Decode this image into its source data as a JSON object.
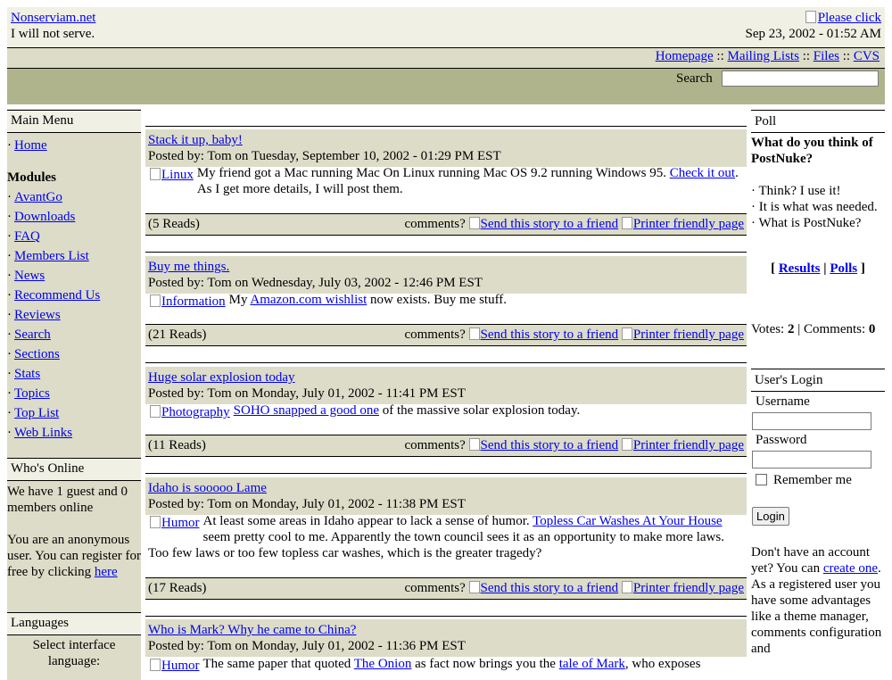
{
  "header": {
    "site_name": "Nonserviam.net",
    "tagline": "I will not serve.",
    "banner_alt": "Please click",
    "datetime": "Sep 23, 2002 - 01:52 AM"
  },
  "nav": {
    "links": [
      "Homepage",
      "Mailing Lists",
      "Files",
      "CVS"
    ],
    "separator": "::"
  },
  "search": {
    "label": "Search",
    "value": ""
  },
  "main_menu": {
    "title": "Main Menu",
    "home": "Home",
    "modules_heading": "Modules",
    "modules": [
      "AvantGo",
      "Downloads",
      "FAQ",
      "Members List",
      "News",
      "Recommend Us",
      "Reviews",
      "Search",
      "Sections",
      "Stats",
      "Topics",
      "Top List",
      "Web Links"
    ]
  },
  "whos_online": {
    "title": "Who's Online",
    "line1": "We have 1 guest and 0 members online",
    "line2": "You are an anonymous user. You can register for free by clicking",
    "link": "here"
  },
  "languages": {
    "title": "Languages",
    "text": "Select interface language:"
  },
  "stories": [
    {
      "title": "Stack it up, baby!",
      "posted": "Posted by: Tom on Tuesday, September 10, 2002 - 01:29 PM EST",
      "topic_alt": "Linux",
      "text_a": "My friend got a Mac running Mac On Linux running Mac OS 9.2 running Windows 95. ",
      "link": "Check it out",
      "text_b": ". As I get more details, I will post them.",
      "reads": "(5 Reads)"
    },
    {
      "title": "Buy me things.",
      "posted": "Posted by: Tom on Wednesday, July 03, 2002 - 12:46 PM EST",
      "topic_alt": "Information",
      "text_a": "My ",
      "link": "Amazon.com wishlist",
      "text_b": " now exists. Buy me stuff.",
      "reads": "(21 Reads)"
    },
    {
      "title": "Huge solar explosion today",
      "posted": "Posted by: Tom on Monday, July 01, 2002 - 11:41 PM EST",
      "topic_alt": "Photography",
      "text_a": "",
      "link": "SOHO snapped a good one",
      "text_b": " of the massive solar explosion today.",
      "reads": "(11 Reads)"
    },
    {
      "title": "Idaho is sooooo Lame",
      "posted": "Posted by: Tom on Monday, July 01, 2002 - 11:38 PM EST",
      "topic_alt": "Humor",
      "text_a": "At least some areas in Idaho appear to lack a sense of humor. ",
      "link": "Topless Car Washes At Your House",
      "text_b": " seem pretty cool to me. Apparently the town council sees it as an opportunity to make more laws. Too few laws or too few topless car washes, which is the greater tragedy?",
      "reads": "(17 Reads)"
    },
    {
      "title": "Who is Mark? Why he came to China?",
      "posted": "Posted by: Tom on Monday, July 01, 2002 - 11:36 PM EST",
      "topic_alt": "Humor",
      "text_a": "The same paper that quoted ",
      "link": "The Onion",
      "text_b": " as fact now brings you the ",
      "link2": "tale of Mark",
      "text_c": ", who exposes"
    }
  ],
  "story_footer": {
    "comments": "comments?",
    "send": "Send this story to a friend",
    "print": "Printer friendly page"
  },
  "poll": {
    "title": "Poll",
    "question": "What do you think of PostNuke?",
    "options": [
      "Think? I use it!",
      "It is what was needed.",
      "What is PostNuke?"
    ],
    "results": "Results",
    "polls": "Polls",
    "votes_label": "Votes:",
    "votes": "2",
    "comments_label": "Comments:",
    "comments": "0"
  },
  "login": {
    "title": "User's Login",
    "username_label": "Username",
    "password_label": "Password",
    "remember": "Remember me",
    "button": "Login",
    "text_a": "Don't have an account yet? You can ",
    "create_link": "create one",
    "text_b": ". As a registered user you have some advantages like a theme manager, comments configuration and"
  }
}
